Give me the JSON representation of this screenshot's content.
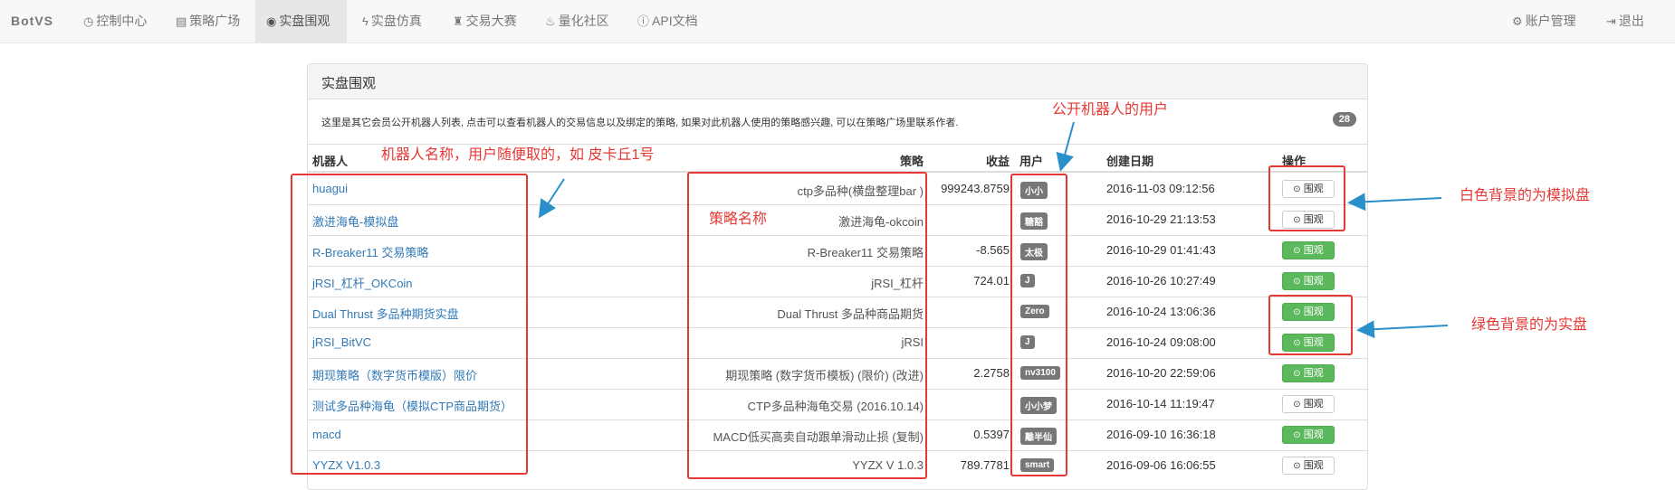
{
  "nav": {
    "brand": "BotVS",
    "items": [
      {
        "icon": "◷",
        "icon_name": "dashboard-icon",
        "label": "控制中心"
      },
      {
        "icon": "▤",
        "icon_name": "store-icon",
        "label": "策略广场"
      },
      {
        "icon": "◉",
        "icon_name": "eye-icon",
        "label": "实盘围观"
      },
      {
        "icon": "ϟ",
        "icon_name": "bolt-icon",
        "label": "实盘仿真"
      },
      {
        "icon": "♜",
        "icon_name": "trophy-icon",
        "label": "交易大赛"
      },
      {
        "icon": "♨",
        "icon_name": "fire-icon",
        "label": "量化社区"
      },
      {
        "icon": "ⓘ",
        "icon_name": "info-icon",
        "label": "API文档"
      }
    ],
    "right": [
      {
        "icon": "⚙",
        "icon_name": "gear-icon",
        "label": "账户管理"
      },
      {
        "icon": "⇥",
        "icon_name": "logout-icon",
        "label": "退出"
      }
    ]
  },
  "panel": {
    "title": "实盘围观",
    "description": "这里是其它会员公开机器人列表, 点击可以查看机器人的交易信息以及绑定的策略, 如果对此机器人使用的策略感兴趣, 可以在策略广场里联系作者.",
    "count": "28"
  },
  "table": {
    "headers": {
      "robot": "机器人",
      "strategy": "策略",
      "profit": "收益",
      "user": "用户",
      "date": "创建日期",
      "action": "操作"
    },
    "button_label": "围观",
    "rows": [
      {
        "robot": "huagui",
        "strategy": "ctp多品种(横盘整理bar )",
        "profit": "999243.8759",
        "user": "小小",
        "date": "2016-11-03 09:12:56",
        "real": false
      },
      {
        "robot": "激进海龟-模拟盘",
        "strategy": "激进海龟-okcoin",
        "profit": "",
        "user": "糖豁",
        "date": "2016-10-29 21:13:53",
        "real": false
      },
      {
        "robot": "R-Breaker11 交易策略",
        "strategy": "R-Breaker11 交易策略",
        "profit": "-8.565",
        "user": "太极",
        "date": "2016-10-29 01:41:43",
        "real": true
      },
      {
        "robot": "jRSI_杠杆_OKCoin",
        "strategy": "jRSI_杠杆",
        "profit": "724.01",
        "user": "J",
        "date": "2016-10-26 10:27:49",
        "real": true
      },
      {
        "robot": "Dual Thrust 多品种期货实盘",
        "strategy": "Dual Thrust 多品种商品期货",
        "profit": "",
        "user": "Zero",
        "date": "2016-10-24 13:06:36",
        "real": true
      },
      {
        "robot": "jRSI_BitVC",
        "strategy": "jRSI",
        "profit": "",
        "user": "J",
        "date": "2016-10-24 09:08:00",
        "real": true
      },
      {
        "robot": "期现策略（数字货币模版）限价",
        "strategy": "期现策略 (数字货币模板) (限价) (改进)",
        "profit": "2.2758",
        "user": "nv3100",
        "date": "2016-10-20 22:59:06",
        "real": true
      },
      {
        "robot": "测试多品种海龟（模拟CTP商品期货）",
        "strategy": "CTP多品种海龟交易 (2016.10.14)",
        "profit": "",
        "user": "小小梦",
        "date": "2016-10-14 11:19:47",
        "real": false
      },
      {
        "robot": "macd",
        "strategy": "MACD低买高卖自动跟单滑动止损 (复制)",
        "profit": "0.5397",
        "user": "離半仙",
        "date": "2016-09-10 16:36:18",
        "real": true
      },
      {
        "robot": "YYZX V1.0.3",
        "strategy": "YYZX V 1.0.3",
        "profit": "789.7781",
        "user": "smart",
        "date": "2016-09-06 16:06:55",
        "real": false
      }
    ]
  },
  "annotations": {
    "robot_name": "机器人名称，用户随便取的，如 皮卡丘1号",
    "strategy_name": "策略名称",
    "public_user": "公开机器人的用户",
    "white_bg": "白色背景的为模拟盘",
    "green_bg": "绿色背景的为实盘",
    "color": "#e53935",
    "arrow_color": "#2b8fc9"
  }
}
